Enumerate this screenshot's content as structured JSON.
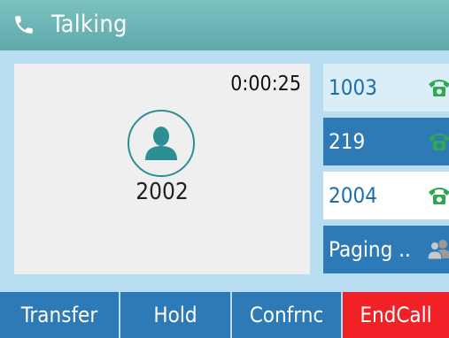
{
  "status": {
    "title": "Talking",
    "icon": "handset-icon"
  },
  "call": {
    "duration": "0:00:25",
    "caller_number": "2002",
    "avatar_icon": "contact-avatar-icon"
  },
  "line_keys": [
    {
      "label": "1003",
      "icon": "handset-icon",
      "icon_color": "#2fa84f"
    },
    {
      "label": "219",
      "icon": "handset-icon",
      "icon_color": "#2fa84f"
    },
    {
      "label": "2004",
      "icon": "handset-icon",
      "icon_color": "#2fa84f"
    },
    {
      "label": "Paging ..",
      "icon": "paging-group-icon",
      "icon_color": "#9a9a9a"
    }
  ],
  "softkeys": [
    {
      "label": "Transfer"
    },
    {
      "label": "Hold"
    },
    {
      "label": "Confrnc"
    },
    {
      "label": "EndCall"
    }
  ],
  "colors": {
    "titlebar": "#6cb6b8",
    "background": "#b8ddf1",
    "softkey": "#2d7ab6",
    "end_call": "#f02127",
    "accent": "#2b8f93"
  }
}
